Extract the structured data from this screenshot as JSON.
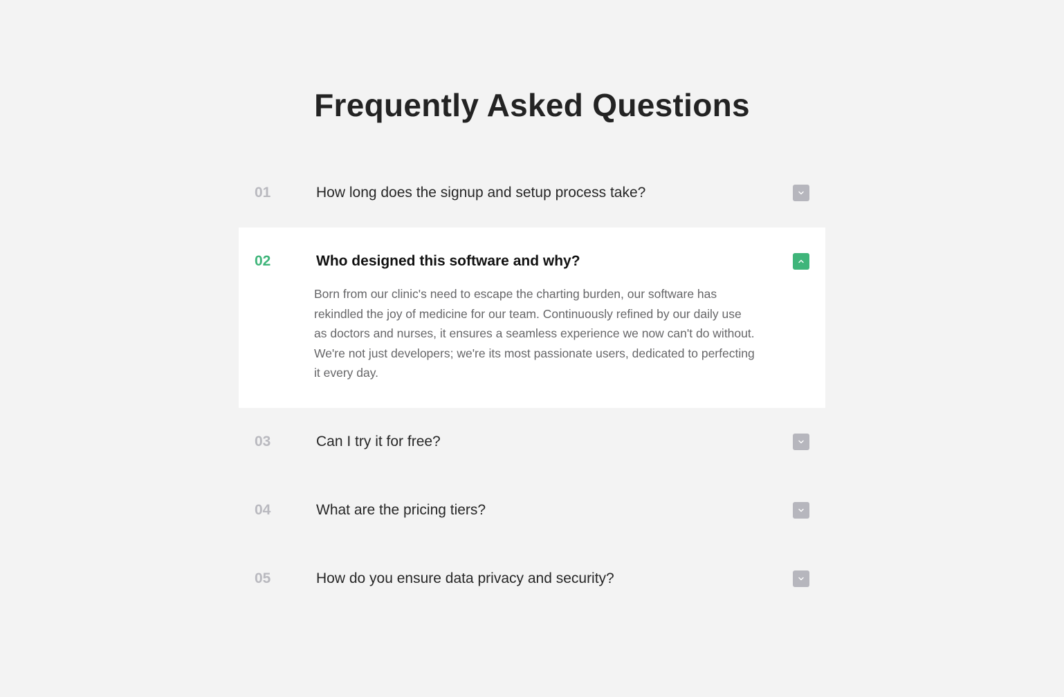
{
  "page": {
    "title": "Frequently Asked Questions"
  },
  "colors": {
    "background": "#f3f3f3",
    "accent": "#3fb57a",
    "muted": "#b6b6bd",
    "open_panel": "#ffffff"
  },
  "faq": {
    "items": [
      {
        "number": "01",
        "question": "How long does the signup and setup process take?",
        "expanded": false,
        "toggle_icon": "chevron-down-icon"
      },
      {
        "number": "02",
        "question": "Who designed this software and why?",
        "expanded": true,
        "toggle_icon": "chevron-up-icon",
        "answer": "Born from our clinic's need to escape the charting burden, our software has rekindled the joy of medicine for our team. Continuously refined by our daily use as doctors and nurses, it ensures a seamless experience we now can't do without. We're not just developers; we're its most passionate users, dedicated to perfecting it every day."
      },
      {
        "number": "03",
        "question": "Can I try it for free?",
        "expanded": false,
        "toggle_icon": "chevron-down-icon"
      },
      {
        "number": "04",
        "question": "What are the pricing tiers?",
        "expanded": false,
        "toggle_icon": "chevron-down-icon"
      },
      {
        "number": "05",
        "question": "How do you ensure data privacy and security?",
        "expanded": false,
        "toggle_icon": "chevron-down-icon"
      }
    ]
  }
}
